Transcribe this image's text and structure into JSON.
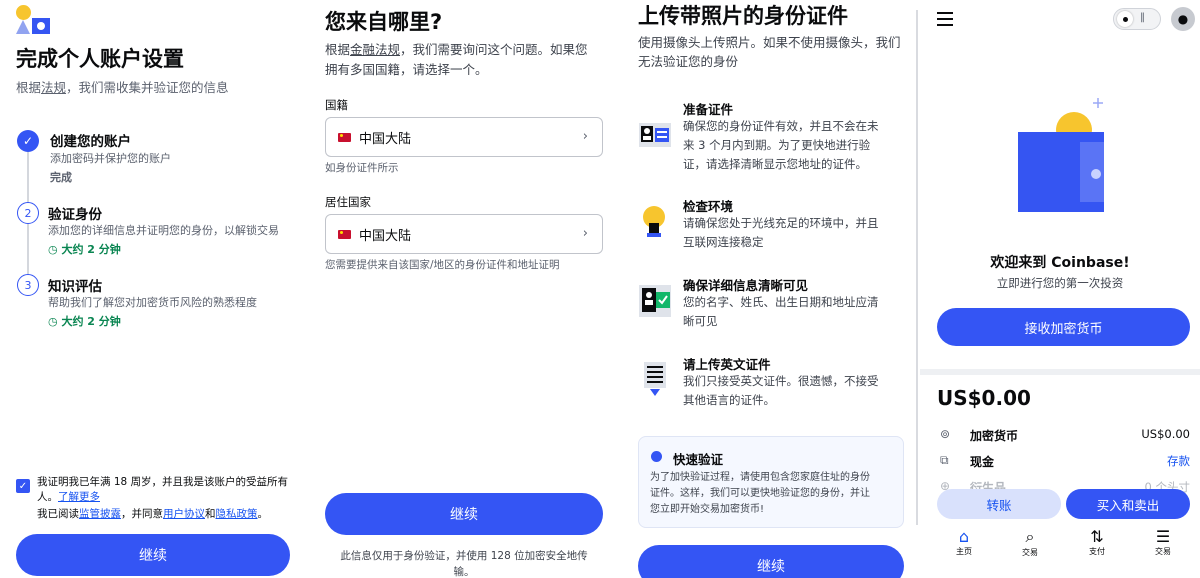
{
  "panel1": {
    "title": "完成个人账户设置",
    "subtitle_prefix": "根据",
    "subtitle_link": "法规",
    "subtitle_suffix": "，我们需收集并验证您的信息",
    "steps": [
      {
        "num": "✓",
        "title": "创建您的账户",
        "desc": "添加密码并保护您的账户",
        "status": "完成"
      },
      {
        "num": "2",
        "title": "验证身份",
        "desc": "添加您的详细信息并证明您的身份，以解锁交易",
        "time": "大约 2 分钟"
      },
      {
        "num": "3",
        "title": "知识评估",
        "desc": "帮助我们了解您对加密货币风险的熟悉程度",
        "time": "大约 2 分钟"
      }
    ],
    "consent_line1": "我证明我已年满 18 周岁，并且我是该账户的受益所有",
    "consent_line2_prefix": "人。",
    "consent_learn_more": "了解更多",
    "agree_prefix": "我已阅读",
    "agree_link1": "监管披露",
    "agree_mid": "，并同意",
    "agree_link2": "用户协议",
    "agree_and": "和",
    "agree_link3": "隐私政策",
    "agree_end": "。",
    "continue": "继续"
  },
  "panel2": {
    "title": "您来自哪里?",
    "desc_prefix": "根据",
    "desc_link": "金融法规",
    "desc_line1_suffix": "，我们需要询问这个问题。如果您",
    "desc_line2": "拥有多国国籍，请选择一个。",
    "nationality_label": "国籍",
    "nationality_value": "中国大陆",
    "nationality_hint": "如身份证件所示",
    "residence_label": "居住国家",
    "residence_value": "中国大陆",
    "residence_hint": "您需要提供来自该国家/地区的身份证件和地址证明",
    "continue": "继续",
    "footer_line1": "此信息仅用于身份验证，并使用 128 位加密安全地传",
    "footer_line2": "输。"
  },
  "panel3": {
    "title": "上传带照片的身份证件",
    "desc_line1": "使用摄像头上传照片。如果不使用摄像头，我们",
    "desc_line2": "无法验证您的身份",
    "items": [
      {
        "icon": "id-card-icon",
        "title": "准备证件",
        "lines": [
          "确保您的身份证件有效，并且不会在未",
          "来 3 个月内到期。为了更快地进行验",
          "证，请选择清晰显示您地址的证件。"
        ]
      },
      {
        "icon": "lightbulb-icon",
        "title": "检查环境",
        "lines": [
          "请确保您处于光线充足的环境中，并且",
          "互联网连接稳定"
        ]
      },
      {
        "icon": "id-verified-icon",
        "title": "确保详细信息清晰可见",
        "lines": [
          "您的名字、姓氏、出生日期和地址应清",
          "晰可见"
        ]
      },
      {
        "icon": "document-upload-icon",
        "title": "请上传英文证件",
        "lines": [
          "我们只接受英文证件。很遗憾，不接受",
          "其他语言的证件。"
        ]
      }
    ],
    "notice_title": "快速验证",
    "notice_lines": [
      "为了加快验证过程，请使用包含您家庭住址的身份",
      "证件。这样，我们可以更快地验证您的身份，并让",
      "您立即开始交易加密货币!"
    ],
    "continue": "继续"
  },
  "panel4": {
    "welcome": "欢迎来到 Coinbase!",
    "welcome_sub": "立即进行您的第一次投资",
    "receive_button": "接收加密货币",
    "balance": "US$0.00",
    "rows": [
      {
        "icon": "crypto-icon",
        "label": "加密货币",
        "value": "US$0.00"
      },
      {
        "icon": "cash-icon",
        "label": "现金",
        "value": "存款"
      },
      {
        "icon": "derivatives-icon",
        "label": "衍生品",
        "value": "0 个头寸"
      }
    ],
    "transfer_button": "转账",
    "buy_sell_button": "买入和卖出",
    "nav": [
      {
        "icon": "home-icon",
        "label": "主页"
      },
      {
        "icon": "search-trade-icon",
        "label": "交易"
      },
      {
        "icon": "pay-icon",
        "label": "支付"
      },
      {
        "icon": "transactions-icon",
        "label": "交易"
      }
    ],
    "colors": {
      "accent": "#3455f4",
      "success": "#098551"
    }
  }
}
